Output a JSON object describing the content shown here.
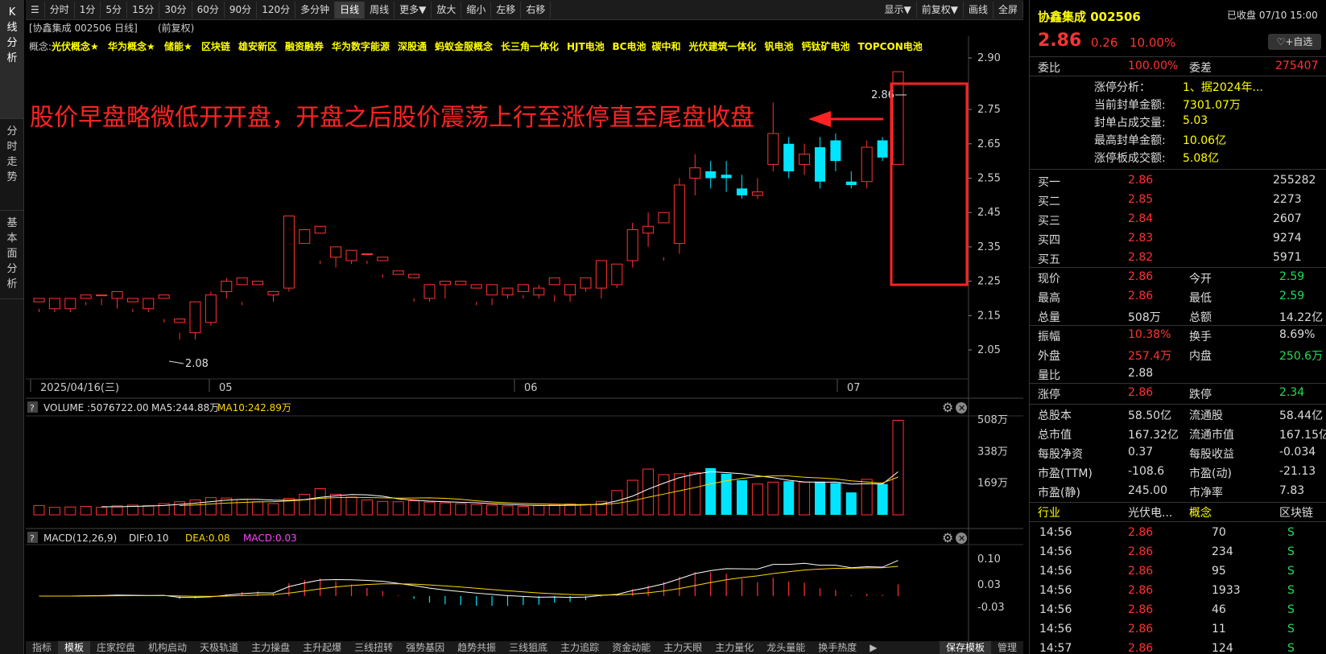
{
  "sidetabs": [
    "K线分析",
    "分时走势",
    "基本面分析"
  ],
  "toolbar": {
    "items": [
      "分时",
      "1分",
      "5分",
      "15分",
      "30分",
      "60分",
      "90分",
      "120分",
      "多分钟",
      "日线",
      "周线",
      "更多▼",
      "放大",
      "缩小",
      "左移",
      "右移"
    ],
    "right": [
      "显示▼",
      "前复权▼",
      "画线",
      "全屏"
    ],
    "active": "日线",
    "menu_icon": "hamburger-icon"
  },
  "header": {
    "title": "[协鑫集成 002506 日线]",
    "adj": "(前复权)"
  },
  "concepts": {
    "label": "概念:",
    "items": [
      "光伏概念★",
      "华为概念★",
      "储能★",
      "区块链",
      "雄安新区",
      "融资融券",
      "华为数字能源",
      "深股通",
      "蚂蚁金服概念",
      "长三角一体化",
      "HJT电池",
      "BC电池",
      "碳中和",
      "光伏建筑一体化",
      "钒电池",
      "钙钛矿电池",
      "TOPCON电池"
    ]
  },
  "annotation": "股价早盘略微低开开盘，开盘之后股价震荡上行至涨停直至尾盘收盘",
  "colors": {
    "up": "#ff3333",
    "down": "#00e5ff",
    "ma5": "#ffffff",
    "ma10": "#ffd700",
    "highlight": "#ff2222"
  },
  "chart_data": [
    {
      "type": "candlestick",
      "title": "协鑫集成 002506 日线",
      "ylim": [
        2.02,
        2.93
      ],
      "yticks": [
        "2.90",
        "2.75",
        "2.65",
        "2.55",
        "2.45",
        "2.35",
        "2.25",
        "2.15",
        "2.05"
      ],
      "xlabels": [
        "2025/04/16(三)",
        "05",
        "06",
        "07"
      ],
      "candles": [
        [
          2.19,
          2.2,
          2.17,
          2.16
        ],
        [
          2.17,
          2.2,
          2.19,
          2.16
        ],
        [
          2.17,
          2.2,
          2.19,
          2.16
        ],
        [
          2.2,
          2.21,
          2.19,
          2.18
        ],
        [
          2.21,
          2.21,
          2.2,
          2.18
        ],
        [
          2.2,
          2.22,
          2.2,
          2.17
        ],
        [
          2.19,
          2.2,
          2.17,
          2.16
        ],
        [
          2.17,
          2.2,
          2.17,
          2.16
        ],
        [
          2.2,
          2.21,
          2.14,
          2.13
        ],
        [
          2.13,
          2.14,
          2.1,
          2.08
        ],
        [
          2.1,
          2.19,
          2.12,
          2.08
        ],
        [
          2.13,
          2.21,
          2.22,
          2.12
        ],
        [
          2.22,
          2.25,
          2.26,
          2.2
        ],
        [
          2.24,
          2.26,
          2.19,
          2.18
        ],
        [
          2.24,
          2.25,
          2.18,
          2.18
        ],
        [
          2.21,
          2.22,
          2.22,
          2.19
        ],
        [
          2.23,
          2.44,
          2.43,
          2.22
        ],
        [
          2.36,
          2.4,
          2.37,
          2.36
        ],
        [
          2.39,
          2.41,
          2.31,
          2.3
        ],
        [
          2.32,
          2.35,
          2.32,
          2.29
        ],
        [
          2.31,
          2.34,
          2.33,
          2.3
        ],
        [
          2.33,
          2.33,
          2.31,
          2.3
        ],
        [
          2.31,
          2.32,
          2.27,
          2.26
        ],
        [
          2.27,
          2.28,
          2.25,
          2.25
        ],
        [
          2.26,
          2.27,
          2.2,
          2.19
        ],
        [
          2.2,
          2.24,
          2.24,
          2.19
        ],
        [
          2.24,
          2.25,
          2.24,
          2.2
        ],
        [
          2.24,
          2.25,
          2.18,
          2.18
        ],
        [
          2.23,
          2.24,
          2.19,
          2.18
        ],
        [
          2.21,
          2.24,
          2.2,
          2.18
        ],
        [
          2.21,
          2.23,
          2.22,
          2.2
        ],
        [
          2.22,
          2.24,
          2.21,
          2.2
        ],
        [
          2.21,
          2.23,
          2.24,
          2.2
        ],
        [
          2.24,
          2.26,
          2.21,
          2.19
        ],
        [
          2.21,
          2.24,
          2.24,
          2.19
        ],
        [
          2.23,
          2.26,
          2.24,
          2.22
        ],
        [
          2.23,
          2.31,
          2.27,
          2.2
        ],
        [
          2.24,
          2.3,
          2.29,
          2.23
        ],
        [
          2.31,
          2.4,
          2.42,
          2.29
        ],
        [
          2.39,
          2.41,
          2.45,
          2.35
        ],
        [
          2.42,
          2.45,
          2.32,
          2.31
        ],
        [
          2.36,
          2.53,
          2.55,
          2.33
        ],
        [
          2.55,
          2.58,
          2.62,
          2.5
        ],
        [
          2.57,
          2.55,
          2.6,
          2.52
        ],
        [
          2.56,
          2.55,
          2.6,
          2.51
        ],
        [
          2.52,
          2.5,
          2.56,
          2.49
        ],
        [
          2.5,
          2.51,
          2.55,
          2.49
        ],
        [
          2.59,
          2.68,
          2.77,
          2.57
        ],
        [
          2.65,
          2.57,
          2.67,
          2.55
        ],
        [
          2.59,
          2.62,
          2.65,
          2.56
        ],
        [
          2.64,
          2.54,
          2.67,
          2.52
        ],
        [
          2.66,
          2.6,
          2.68,
          2.57
        ],
        [
          2.54,
          2.53,
          2.57,
          2.52
        ],
        [
          2.54,
          2.64,
          2.66,
          2.52
        ],
        [
          2.66,
          2.61,
          2.67,
          2.6
        ],
        [
          2.59,
          2.86,
          2.86,
          2.59
        ]
      ],
      "annotations": [
        "2.08",
        "2.86"
      ]
    },
    {
      "type": "bar",
      "title": "VOLUME",
      "series": [
        {
          "name": "VOLUME",
          "values": [
            50,
            40,
            42,
            45,
            40,
            48,
            52,
            50,
            60,
            70,
            80,
            92,
            90,
            82,
            70,
            60,
            88,
            110,
            140,
            110,
            95,
            80,
            72,
            70,
            75,
            68,
            64,
            60,
            55,
            52,
            48,
            45,
            50,
            55,
            58,
            56,
            72,
            130,
            185,
            245,
            215,
            220,
            225,
            250,
            220,
            185,
            165,
            175,
            180,
            175,
            178,
            170,
            120,
            190,
            165,
            506
          ]
        },
        {
          "name": "MA5",
          "values": []
        },
        {
          "name": "MA10",
          "values": []
        }
      ],
      "labels": {
        "volume": "VOLUME :5076722.00",
        "ma5": "MA5:244.88万",
        "ma10": "MA10:242.89万"
      },
      "yticks": [
        "508万",
        "338万",
        "169万"
      ]
    },
    {
      "type": "bar",
      "title": "MACD(12,26,9)",
      "labels": {
        "title": "MACD(12,26,9)",
        "dif": "DIF:0.10",
        "dea": "DEA:0.08",
        "macd": "MACD:0.03"
      },
      "yticks": [
        "0.10",
        "0.03",
        "-0.03"
      ]
    }
  ],
  "right_panel": {
    "name": "协鑫集成 002506",
    "status": "已收盘 07/10 15:00",
    "price": "2.86",
    "change": "0.26",
    "pct": "10.00%",
    "watch": "♡+自选",
    "weibi": {
      "label1": "委比",
      "val1": "100.00%",
      "label2": "委差",
      "val2": "275407"
    },
    "limit": [
      {
        "k": "涨停分析：",
        "v": "1、据2024年..."
      },
      {
        "k": "当前封单金额:",
        "v": "7301.07万"
      },
      {
        "k": "封单占成交量:",
        "v": "5.03"
      },
      {
        "k": "最高封单金额:",
        "v": "10.06亿"
      },
      {
        "k": "涨停板成交额:",
        "v": "5.08亿"
      }
    ],
    "buys": [
      {
        "k": "买一",
        "p": "2.86",
        "v": "255282"
      },
      {
        "k": "买二",
        "p": "2.85",
        "v": "2273"
      },
      {
        "k": "买三",
        "p": "2.84",
        "v": "2607"
      },
      {
        "k": "买四",
        "p": "2.83",
        "v": "9274"
      },
      {
        "k": "买五",
        "p": "2.82",
        "v": "5971"
      }
    ],
    "stats1": [
      [
        {
          "k": "现价",
          "v": "2.86",
          "c": "red"
        },
        {
          "k": "今开",
          "v": "2.59",
          "c": "green"
        }
      ],
      [
        {
          "k": "最高",
          "v": "2.86",
          "c": "red"
        },
        {
          "k": "最低",
          "v": "2.59",
          "c": "green"
        }
      ],
      [
        {
          "k": "总量",
          "v": "508万",
          "c": "white"
        },
        {
          "k": "总额",
          "v": "14.22亿",
          "c": "white"
        }
      ]
    ],
    "stats2": [
      [
        {
          "k": "振幅",
          "v": "10.38%",
          "c": "red"
        },
        {
          "k": "换手",
          "v": "8.69%",
          "c": "white"
        }
      ],
      [
        {
          "k": "外盘",
          "v": "257.4万",
          "c": "red"
        },
        {
          "k": "内盘",
          "v": "250.6万",
          "c": "green"
        }
      ],
      [
        {
          "k": "量比",
          "v": "2.88",
          "c": "white"
        },
        {
          "k": "",
          "v": "",
          "c": "white"
        }
      ]
    ],
    "stats3": [
      {
        "k": "涨停",
        "v": "2.86",
        "c": "red"
      },
      {
        "k": "跌停",
        "v": "2.34",
        "c": "green"
      }
    ],
    "stats4": [
      [
        {
          "k": "总股本",
          "v": "58.50亿",
          "c": "white"
        },
        {
          "k": "流通股",
          "v": "58.44亿",
          "c": "white"
        }
      ],
      [
        {
          "k": "总市值",
          "v": "167.32亿",
          "c": "white"
        },
        {
          "k": "流通市值",
          "v": "167.15亿",
          "c": "white"
        }
      ],
      [
        {
          "k": "每股净资",
          "v": "0.37",
          "c": "white"
        },
        {
          "k": "每股收益",
          "v": "-0.034",
          "c": "white"
        }
      ],
      [
        {
          "k": "市盈(TTM)",
          "v": "-108.6",
          "c": "white"
        },
        {
          "k": "市盈(动)",
          "v": "-21.13",
          "c": "white"
        }
      ],
      [
        {
          "k": "市盈(静)",
          "v": "245.00",
          "c": "white"
        },
        {
          "k": "市净率",
          "v": "7.83",
          "c": "white"
        }
      ]
    ],
    "industry": {
      "k1": "行业",
      "v1": "光伏电...",
      "k2": "概念",
      "v2": "区块链"
    },
    "ticks": [
      {
        "t": "14:56",
        "p": "2.86",
        "v": "70",
        "s": "S"
      },
      {
        "t": "14:56",
        "p": "2.86",
        "v": "234",
        "s": "S"
      },
      {
        "t": "14:56",
        "p": "2.86",
        "v": "95",
        "s": "S"
      },
      {
        "t": "14:56",
        "p": "2.86",
        "v": "1933",
        "s": "S"
      },
      {
        "t": "14:56",
        "p": "2.86",
        "v": "46",
        "s": "S"
      },
      {
        "t": "14:56",
        "p": "2.86",
        "v": "11",
        "s": "S"
      },
      {
        "t": "14:57",
        "p": "2.86",
        "v": "124",
        "s": "S"
      }
    ]
  },
  "bottom": [
    "指标",
    "模板",
    "庄家控盘",
    "机构启动",
    "天极轨道",
    "主力操盘",
    "主升起爆",
    "三线扭转",
    "强势基因",
    "趋势共振",
    "三线狙底",
    "主力追踪",
    "资金动能",
    "主力天眼",
    "主力量化",
    "龙头量能",
    "换手热度",
    "▶",
    "保存模板",
    "管理"
  ]
}
